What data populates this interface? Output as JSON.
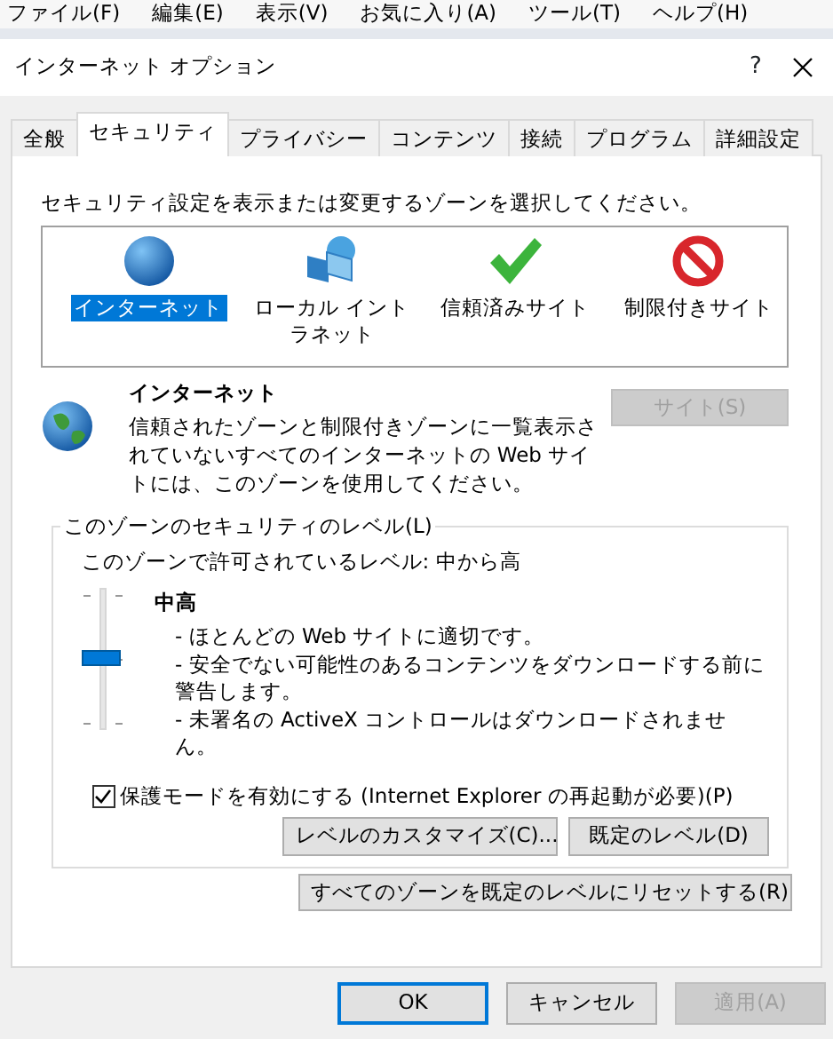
{
  "menu_bar": [
    "ファイル(F)",
    "編集(E)",
    "表示(V)",
    "お気に入り(A)",
    "ツール(T)",
    "ヘルプ(H)"
  ],
  "window": {
    "title": "インターネット オプション",
    "help": "?"
  },
  "tabs": [
    {
      "label": "全般",
      "selected": false
    },
    {
      "label": "セキュリティ",
      "selected": true
    },
    {
      "label": "プライバシー",
      "selected": false
    },
    {
      "label": "コンテンツ",
      "selected": false
    },
    {
      "label": "接続",
      "selected": false
    },
    {
      "label": "プログラム",
      "selected": false
    },
    {
      "label": "詳細設定",
      "selected": false
    }
  ],
  "zone_prompt": "セキュリティ設定を表示または変更するゾーンを選択してください。",
  "zones": [
    {
      "label": "インターネット",
      "kind": "globe",
      "selected": true
    },
    {
      "label": "ローカル イントラネット",
      "kind": "intranet",
      "selected": false
    },
    {
      "label": "信頼済みサイト",
      "kind": "trusted",
      "selected": false
    },
    {
      "label": "制限付きサイト",
      "kind": "restricted",
      "selected": false
    }
  ],
  "zone_detail": {
    "title": "インターネット",
    "description": "信頼されたゾーンと制限付きゾーンに一覧表示されていないすべてのインターネットの Web サイトには、このゾーンを使用してください。",
    "sites_button": {
      "label": "サイト(S)",
      "disabled": true
    }
  },
  "security_level": {
    "legend": "このゾーンのセキュリティのレベル(L)",
    "allowed": "このゾーンで許可されているレベル: 中から高",
    "level": 0.5,
    "level_name": "中高",
    "notes": [
      "- ほとんどの Web サイトに適切です。",
      "- 安全でない可能性のあるコンテンツをダウンロードする前に警告します。",
      "- 未署名の ActiveX コントロールはダウンロードされません。"
    ],
    "protected_mode": {
      "label": "保護モードを有効にする (Internet Explorer の再起動が必要)(P)",
      "checked": true
    },
    "buttons": [
      {
        "label": "レベルのカスタマイズ(C)...",
        "disabled": false
      },
      {
        "label": "既定のレベル(D)",
        "disabled": false
      }
    ]
  },
  "reset_button": {
    "label": "すべてのゾーンを既定のレベルにリセットする(R)",
    "disabled": false
  },
  "footer_buttons": [
    {
      "label": "OK",
      "default": true,
      "disabled": false
    },
    {
      "label": "キャンセル",
      "default": false,
      "disabled": false
    },
    {
      "label": "適用(A)",
      "default": false,
      "disabled": true
    }
  ]
}
